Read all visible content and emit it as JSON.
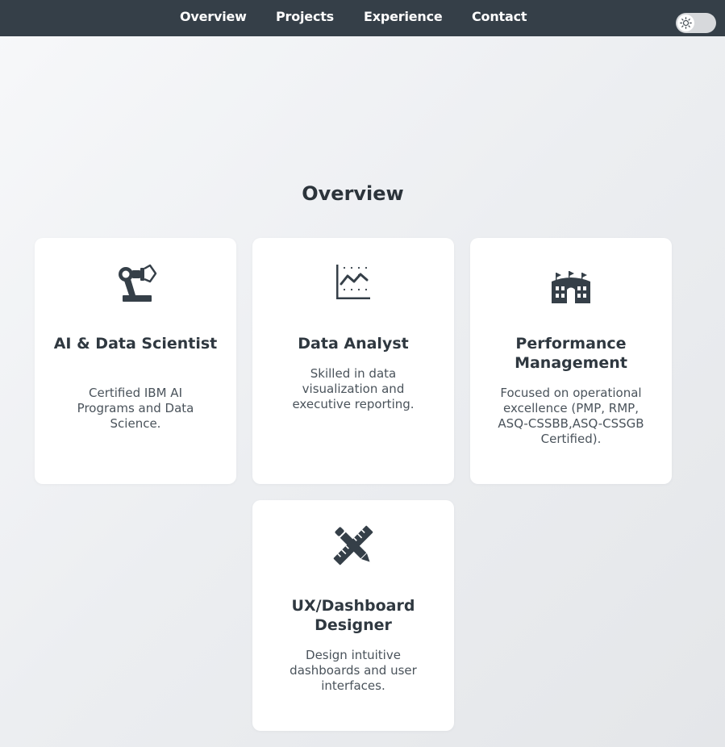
{
  "nav": {
    "links": [
      "Overview",
      "Projects",
      "Experience",
      "Contact"
    ],
    "theme_toggle_icon": "sun-icon"
  },
  "overview": {
    "title": "Overview",
    "cards": [
      {
        "icon": "robot-arm-icon",
        "title": "AI & Data Scientist",
        "description": "Certified IBM AI Programs and Data Science."
      },
      {
        "icon": "line-chart-icon",
        "title": "Data Analyst",
        "description": "Skilled in data visualization and executive reporting."
      },
      {
        "icon": "building-icon",
        "title": "Performance Management",
        "description": "Focused on operational excellence (PMP, RMP, ASQ-CSSBB,ASQ-CSSGB Certified)."
      },
      {
        "icon": "ruler-pencil-icon",
        "title": "UX/Dashboard Designer",
        "description": "Design intuitive dashboards and user interfaces."
      }
    ]
  },
  "colors": {
    "nav_background": "#353f48",
    "card_background": "#ffffff",
    "icon_color": "#353f48"
  }
}
